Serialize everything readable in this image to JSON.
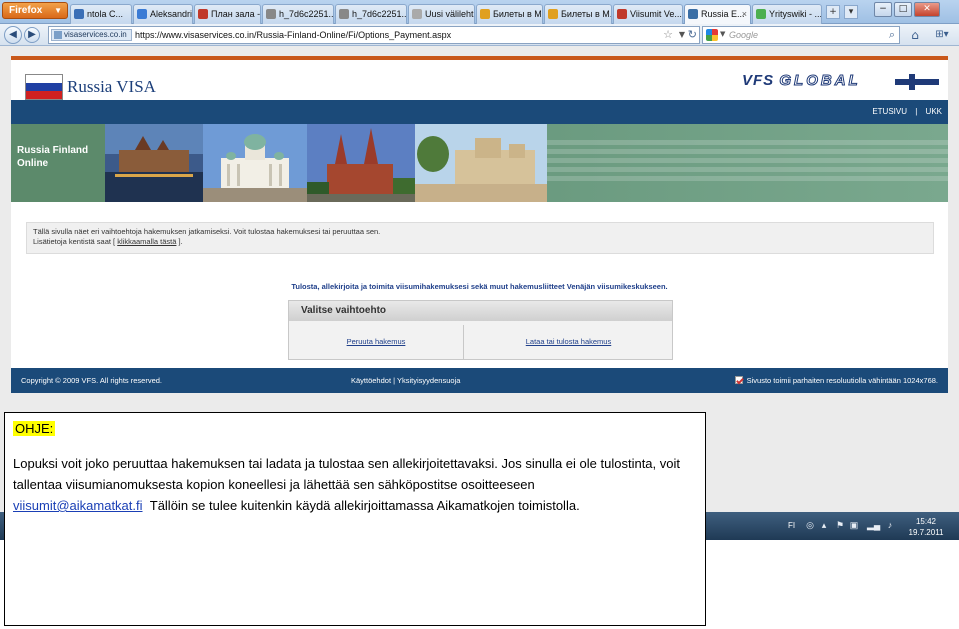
{
  "browser": {
    "app_button": "Firefox",
    "tabs": [
      {
        "label": "ntola C...",
        "color": "#3b6fb6"
      },
      {
        "label": "Aleksandrin...",
        "color": "#3a7bd5"
      },
      {
        "label": "План зала - ...",
        "color": "#c0392b"
      },
      {
        "label": "h_7d6c2251...",
        "color": "#888888"
      },
      {
        "label": "h_7d6c2251...",
        "color": "#888888"
      },
      {
        "label": "Uusi välilehti",
        "color": "#aaaaaa"
      },
      {
        "label": "Билеты в М...",
        "color": "#e0a020"
      },
      {
        "label": "Билеты в М...",
        "color": "#e0a020"
      },
      {
        "label": "Viisumit Ve...",
        "color": "#c0392b"
      },
      {
        "label": "Russia E...",
        "color": "#3a6ea5"
      },
      {
        "label": "Yrityswiki - ...",
        "color": "#4caf50"
      }
    ],
    "tab_close": "×",
    "new_tab": "+",
    "site_badge": "visaservices.co.in",
    "url": "https://www.visaservices.co.in/Russia-Finland-Online/Fi/Options_Payment.aspx",
    "search_engine_icon": "google-icon",
    "search_placeholder": "Google",
    "window_controls": [
      "−",
      "□",
      "✕"
    ]
  },
  "page": {
    "brand_title": "Russia VISA",
    "vfs_logo_bold": "VFS",
    "vfs_logo_outline": "GLOBAL",
    "top_links": [
      "ETUSIVU",
      "|",
      "UKK"
    ],
    "banner_label": "Russia Finland Online",
    "info_line1": "Tällä sivulla näet eri vaihtoehtoja hakemuksen jatkamiseksi. Voit tulostaa hakemuksesi tai peruuttaa sen.",
    "info_line2_prefix": "Lisätietoja kentistä saat [",
    "info_line2_link": "klikkaamalla tästä",
    "info_line2_suffix": "].",
    "instruction": "Tulosta, allekirjoita ja toimita viisumihakemuksesi sekä muut hakemusliitteet Venäjän viisumikeskukseen.",
    "options_title": "Valitse vaihtoehto",
    "option_cancel": "Peruuta hakemus",
    "option_print": "Lataa tai tulosta hakemus",
    "footer_copyright": "Copyright © 2009 VFS. All rights reserved.",
    "footer_links": "Käyttöehdot | Yksityisyydensuoja",
    "footer_resolution": "Sivusto toimii parhaiten resoluutiolla vähintään 1024x768."
  },
  "taskbar": {
    "language": "FI",
    "time": "15:42",
    "date": "19.7.2011"
  },
  "note": {
    "heading": "OHJE:",
    "text_before_email": "Lopuksi voit joko peruuttaa hakemuksen tai ladata ja tulostaa sen allekirjoitettavaksi. Jos sinulla ei ole tulostinta, voit tallentaa viisumianomuksesta kopion koneellesi ja lähettää sen sähköpostitse osoitteeseen",
    "email": "viisumit@aikamatkat.fi",
    "text_after_email": "Tällöin se tulee kuitenkin käydä allekirjoittamassa Aikamatkojen toimistolla."
  }
}
